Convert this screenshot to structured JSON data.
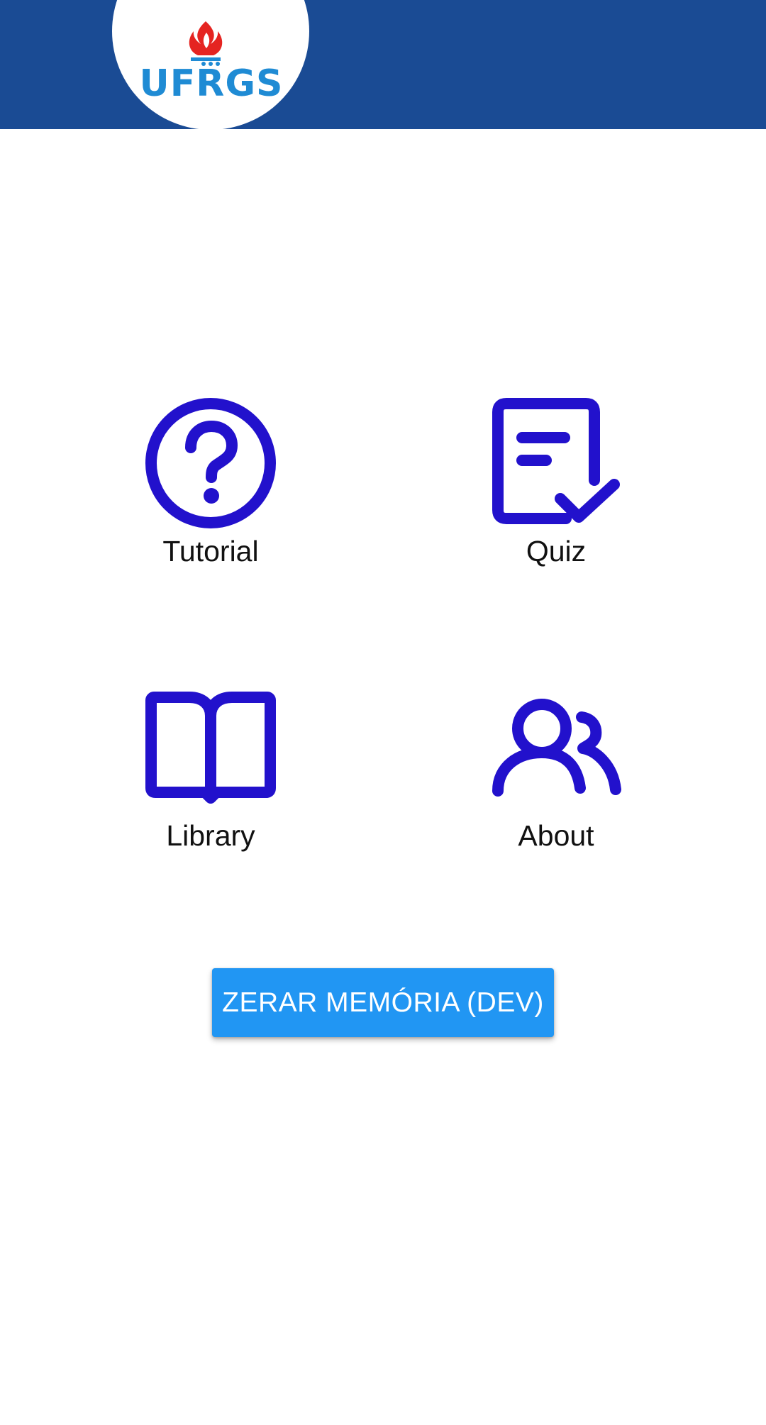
{
  "header": {
    "background_color": "#1A4B94",
    "logo": {
      "text": "UFRGS",
      "text_color": "#1F8BD4",
      "flame_color": "#E52421"
    }
  },
  "menu": {
    "icon_color": "#2211CC",
    "items": [
      {
        "label": "Tutorial",
        "icon": "help-circle-icon"
      },
      {
        "label": "Quiz",
        "icon": "clipboard-check-icon"
      },
      {
        "label": "Library",
        "icon": "open-book-icon"
      },
      {
        "label": "About",
        "icon": "users-icon"
      }
    ]
  },
  "reset_button": {
    "label": "ZERAR MEMÓRIA (DEV)",
    "color": "#2196F3"
  }
}
